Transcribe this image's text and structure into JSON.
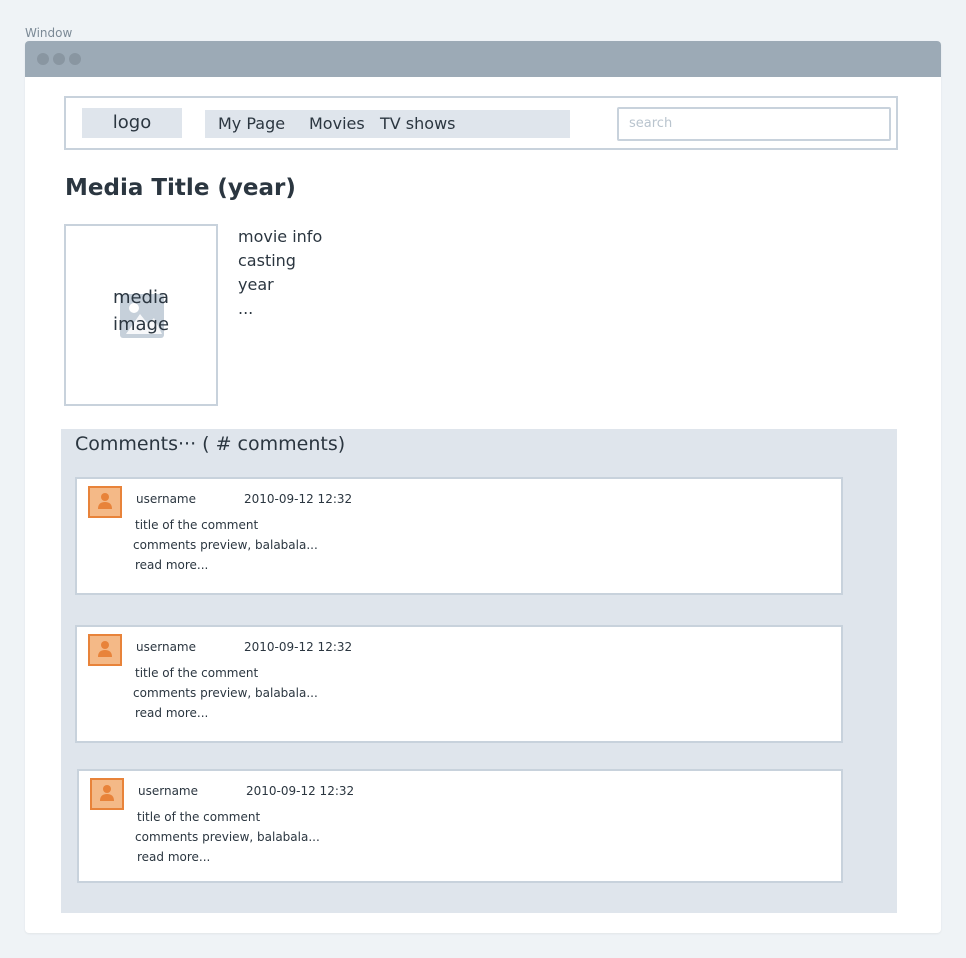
{
  "window": {
    "label": "Window"
  },
  "nav": {
    "logo": "logo",
    "links": [
      "My Page",
      "Movies",
      "TV shows"
    ],
    "search_placeholder": "search"
  },
  "media": {
    "title": "Media Title (year)",
    "image_label_line1": "media",
    "image_label_line2": "image",
    "info": [
      "movie info",
      "casting",
      "year",
      "..."
    ]
  },
  "comments": {
    "header": "Comments··· ( # comments)",
    "items": [
      {
        "username": "username",
        "timestamp": "2010-09-12 12:32",
        "title": "title of the comment",
        "preview": "comments preview, balabala...",
        "more": "read more..."
      },
      {
        "username": "username",
        "timestamp": "2010-09-12 12:32",
        "title": "title of the comment",
        "preview": "comments preview, balabala...",
        "more": "read more..."
      },
      {
        "username": "username",
        "timestamp": "2010-09-12 12:32",
        "title": "title of the comment",
        "preview": "comments preview, balabala...",
        "more": "read more..."
      }
    ]
  }
}
